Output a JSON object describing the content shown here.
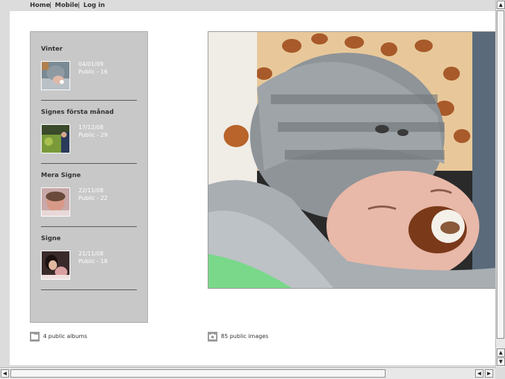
{
  "nav": {
    "home": "Home",
    "mobile": "Mobile",
    "login": "Log in",
    "separator": "|"
  },
  "albums": [
    {
      "title": "Vinter",
      "date": "04/01/09",
      "count": "Public - 16"
    },
    {
      "title": "Signes första månad",
      "date": "17/12/08",
      "count": "Public - 29"
    },
    {
      "title": "Mera Signe",
      "date": "22/11/08",
      "count": "Public - 22"
    },
    {
      "title": "Signe",
      "date": "21/11/08",
      "count": "Public - 18"
    }
  ],
  "footer": {
    "albums_label": "4 public albums",
    "images_label": "85 public images",
    "albums_icon": "folder-icon",
    "images_icon": "image-icon"
  }
}
